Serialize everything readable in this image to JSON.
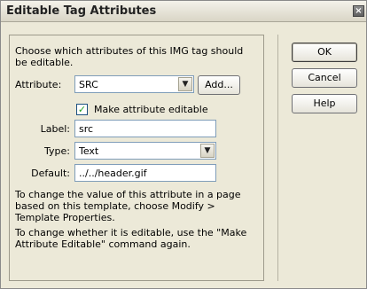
{
  "window": {
    "title": "Editable Tag Attributes",
    "close_glyph": "×"
  },
  "intro_text": "Choose which attributes of this IMG tag should be editable.",
  "attribute": {
    "label": "Attribute:",
    "value": "SRC",
    "add_label": "Add..."
  },
  "make_editable": {
    "checked": true,
    "label": "Make attribute editable"
  },
  "label_field": {
    "label": "Label:",
    "value": "src"
  },
  "type_field": {
    "label": "Type:",
    "value": "Text"
  },
  "default_field": {
    "label": "Default:",
    "value": "../../header.gif"
  },
  "help": {
    "change_value": "To change the value of this attribute in a page based on this template, choose Modify > Template Properties.",
    "change_editable": "To change whether it is editable, use the \"Make Attribute Editable\" command again."
  },
  "buttons": {
    "ok": "OK",
    "cancel": "Cancel",
    "help": "Help"
  },
  "icons": {
    "dropdown": "chevron-down-icon",
    "checkmark": "checkmark-icon",
    "close": "close-icon"
  }
}
